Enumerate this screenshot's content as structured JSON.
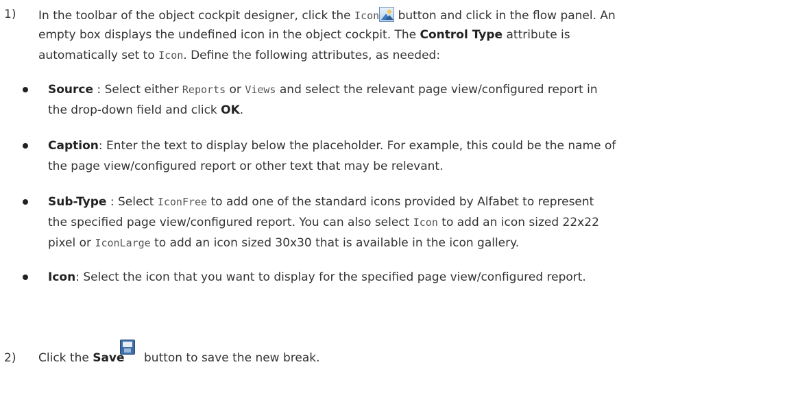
{
  "step1": {
    "num": "1)",
    "l1_a": "In the toolbar of the object cockpit designer, click the ",
    "l1_code": "Icon",
    "l1_b": " button and click in the flow panel. An",
    "l2": "empty box displays the undefined icon in the object cockpit. The ",
    "l2_bold": "Control Type",
    "l2_b": " attribute is",
    "l3_a": "automatically set to ",
    "l3_code": "Icon",
    "l3_b": ". Define the following attributes, as needed:"
  },
  "bullets": {
    "source": {
      "term": "Source",
      "l1_a": " : Select either ",
      "c1": "Reports",
      "l1_b": " or ",
      "c2": "Views",
      "l1_c": " and select the relevant page view/configured report in",
      "l2_a": "the drop-down field and click ",
      "l2_bold": "OK",
      "l2_b": "."
    },
    "caption": {
      "term": "Caption",
      "l1": ": Enter the text to display below the placeholder. For example, this could be the name of",
      "l2": "the page view/configured report or other text that may be relevant."
    },
    "subtype": {
      "term": "Sub-Type",
      "l1_a": " : Select ",
      "c1": "IconFree",
      "l1_b": " to add one of the standard icons provided by Alfabet to represent",
      "l2_a": "the specified page view/configured report. You can also select ",
      "c2": "Icon",
      "l2_b": " to add an icon sized 22x22",
      "l3_a": "pixel or ",
      "c3": "IconLarge",
      "l3_b": " to add an icon sized 30x30 that is available in the icon gallery."
    },
    "icon": {
      "term": "Icon",
      "l1": ": Select the icon that you want to display for the specified page view/configured report."
    }
  },
  "step2": {
    "num": "2)",
    "a": "Click the ",
    "bold": "Save",
    "b": " button to save the new break."
  },
  "icons": {
    "toolbar_icon": "image-icon",
    "save_icon": "save-icon"
  }
}
